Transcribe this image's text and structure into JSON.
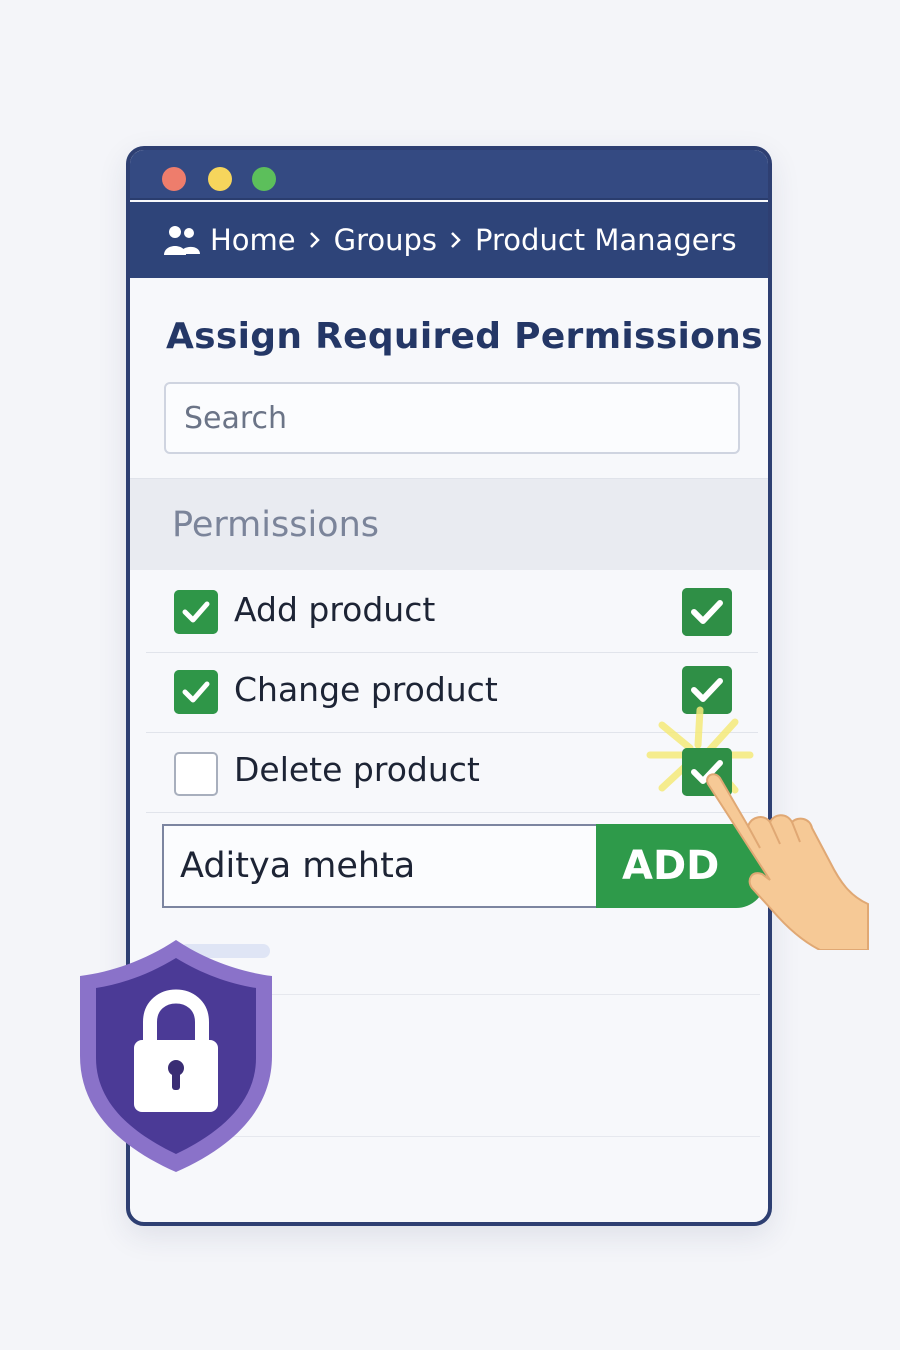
{
  "breadcrumb": {
    "icon": "users-icon",
    "items": [
      "Home",
      "Groups",
      "Product Managers"
    ]
  },
  "window_controls": [
    "close-dot",
    "minimize-dot",
    "maximize-dot"
  ],
  "page": {
    "title": "Assign Required Permissions"
  },
  "search": {
    "placeholder": "Search",
    "value": ""
  },
  "permissions": {
    "header": "Permissions",
    "items": [
      {
        "label": "Add product",
        "checked": true,
        "right_checked": true
      },
      {
        "label": "Change product",
        "checked": true,
        "right_checked": true
      },
      {
        "label": "Delete product",
        "checked": false,
        "right_checked": true
      }
    ]
  },
  "assign": {
    "user_value": "Aditya mehta",
    "button_label": "ADD"
  },
  "decorations": {
    "shield_icon": "shield-lock-icon",
    "hand_icon": "pointing-hand-icon"
  },
  "colors": {
    "header_bg": "#2e4479",
    "accent_green": "#2f9648",
    "shield_purple": "#5a3f9e"
  }
}
